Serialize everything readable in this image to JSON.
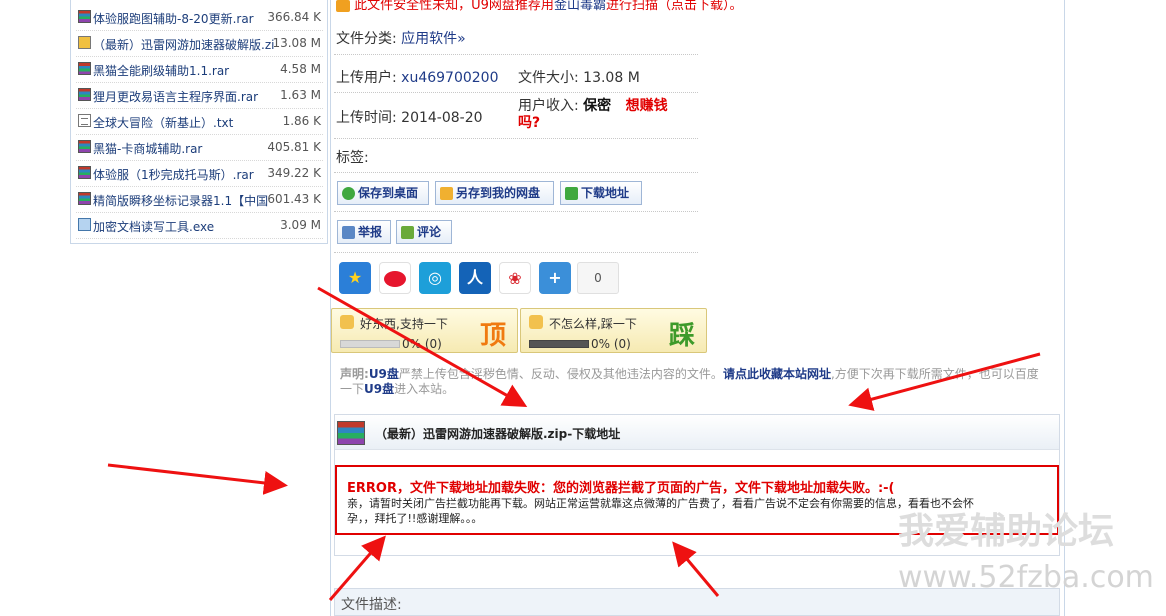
{
  "file_list": [
    {
      "name": "体验服跑图辅助-8-20更新.rar",
      "size": "366.84 K",
      "icon": "rar-archive-icon"
    },
    {
      "name": "（最新）迅雷网游加速器破解版.zip",
      "size": "13.08 M",
      "icon": "zip-archive-icon"
    },
    {
      "name": "黑猫全能刷级辅助1.1.rar",
      "size": "4.58 M",
      "icon": "rar-archive-icon"
    },
    {
      "name": "狸月更改易语言主程序界面.rar",
      "size": "1.63 M",
      "icon": "rar-archive-icon"
    },
    {
      "name": "全球大冒险（新基止）.txt",
      "size": "1.86 K",
      "icon": "text-file-icon"
    },
    {
      "name": "黑猫-卡商城辅助.rar",
      "size": "405.81 K",
      "icon": "rar-archive-icon"
    },
    {
      "name": "体验服（1秒完成托马斯）.rar",
      "size": "349.22 K",
      "icon": "rar-archive-icon"
    },
    {
      "name": "精简版瞬移坐标记录器1.1【中国",
      "size": "601.43 K",
      "icon": "rar-archive-icon"
    },
    {
      "name": "加密文档读写工具.exe",
      "size": "3.09 M",
      "icon": "exe-file-icon"
    }
  ],
  "notice": {
    "part1": "此文件安全性未知，U9网盘推荐用",
    "link": "金山毒霸",
    "part2": "进行扫描",
    "part3": "（点击下载）。"
  },
  "file_info": {
    "category_label": "文件分类:",
    "category_value": "应用软件»",
    "uploader_label": "上传用户:",
    "uploader_value": "xu469700200",
    "size_label": "文件大小:",
    "size_value": "13.08 M",
    "upload_time_label": "上传时间:",
    "upload_time_value": "2014-08-20",
    "income_label": "用户收入:",
    "income_value": "保密",
    "earn_link_line1": "想赚钱",
    "earn_link_line2": "吗?",
    "tags_label": "标签:"
  },
  "buttons": {
    "save_desktop": "保存到桌面",
    "save_netdisk": "另存到我的网盘",
    "download_url": "下载地址",
    "report": "举报",
    "comment": "评论"
  },
  "share": {
    "count": "0",
    "icons": [
      "qzone-star-icon",
      "weibo-icon",
      "tencent-weibo-icon",
      "renren-icon",
      "kaixin-icon",
      "more-share-plus-icon"
    ]
  },
  "votes": {
    "up_text": "好东西,支持一下",
    "up_stat": "0% (0)",
    "up_char": "顶",
    "down_text": "不怎么样,踩一下",
    "down_stat": "0% (0)",
    "down_char": "踩",
    "up_percent": 0,
    "down_percent": 0
  },
  "disclaimer": {
    "label": "声明:",
    "brand": "U9盘",
    "text1": "严禁上传包含淫秽色情、反动、侵权及其他违法内容的文件。",
    "bookmark_link": "请点此收藏本站网址",
    "text2": ",方便下次再下载所需文件，也可以百度",
    "text3": "一下",
    "brand2": "U9盘",
    "text4": "进入本站。"
  },
  "download_section": {
    "title": "（最新）迅雷网游加速器破解版.zip-下载地址",
    "error_title": "ERROR，文件下载地址加载失败：您的浏览器拦截了页面的广告，文件下载地址加载失败。:-(",
    "error_line1": "亲，请暂时关闭广告拦截功能再下载。网站正常运营就靠这点微薄的广告费了，看看广告说不定会有你需要的信息，看看也不会怀",
    "error_line2": "孕，，拜托了!!感谢理解。。。"
  },
  "file_desc_label": "文件描述:",
  "watermark": {
    "cn": "我爱辅助论坛",
    "url": "www.52fzba.com"
  },
  "colors": {
    "red": "#e00000",
    "link_blue": "#1f3b88",
    "border_blue": "#c9d7e8"
  }
}
